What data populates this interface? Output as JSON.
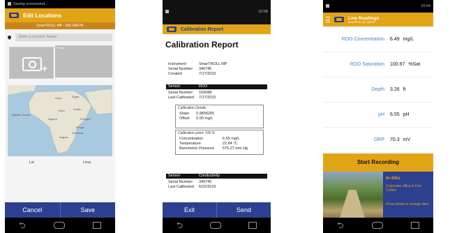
{
  "phone1": {
    "status_text": "Saving screenshot...",
    "title": "Edit Locations",
    "subtitle": "SmarTROLL MP - S/N 346745",
    "search_placeholder": "Enter a location Name",
    "photo2_label": "Photo",
    "map_labels": [
      "Atlantic Ocean",
      "Libya",
      "Egypt",
      "Chad",
      "Sudan",
      "Nigeria",
      "Angola",
      "Ethiopia",
      "Kenya",
      "Tanzania"
    ],
    "lat_label": "Lat",
    "long_label": "Long",
    "cancel_label": "Cancel",
    "save_label": "Save"
  },
  "phone2": {
    "status_time": "10:08",
    "title": "Calibration Report",
    "heading": "Calibration Report",
    "instrument_k": "Instrument",
    "instrument_v": "SmarTROLL MP",
    "serial_k": "Serial Number",
    "serial_v": "346745",
    "created_k": "Created",
    "created_v": "7/17/2015",
    "sensor1_k": "Sensor",
    "sensor1_v": "RDO",
    "s1_serial_k": "Serial Number",
    "s1_serial_v": "159088",
    "s1_cal_k": "Last Calibrated",
    "s1_cal_v": "7/17/2015",
    "cal_details": "Calibration Details",
    "slope_k": "Slope",
    "slope_v": "0.9858205",
    "offset_k": "Offset",
    "offset_v": "0.00 mg/L",
    "cal_point": "Calibration point: 100 %",
    "conc_k": "Concentration",
    "conc_v": "6.55 mg/L",
    "temp_k": "Temperature",
    "temp_v": "22.84 °C",
    "baro_k": "Barometric Pressure",
    "baro_v": "575.27 mm Hg",
    "sensor2_k": "Sensor",
    "sensor2_v": "Conductivity",
    "s2_serial_k": "Serial Number",
    "s2_serial_v": "346745",
    "s2_cal_k": "Last Calibrated",
    "s2_cal_v": "6/22/2015",
    "exit_label": "Exit",
    "send_label": "Send"
  },
  "phone3": {
    "status_time": "10:04",
    "title": "Live Readings",
    "subtitle": "SmarTROLL MP 346745",
    "readings": [
      {
        "label": "RDO Concentration",
        "value": "6.49",
        "unit": "mg/L"
      },
      {
        "label": "RDO Saturation",
        "value": "100.67",
        "unit": "%Sat"
      },
      {
        "label": "Depth",
        "value": "3.26",
        "unit": "ft"
      },
      {
        "label": "pH",
        "value": "6.55",
        "unit": "pH"
      },
      {
        "label": "ORP",
        "value": "70.3",
        "unit": "mV"
      }
    ],
    "start_label": "Start Recording",
    "insitu_title": "In-Situ",
    "insitu_desc": "Corporate office in Fort Collins",
    "insitu_hint": "Press photo to change sites"
  },
  "colors": {
    "accent": "#e2a417",
    "brand": "#2d3f8f",
    "label_blue": "#4d7fbf"
  },
  "icons": [
    "back-icon",
    "home-icon",
    "recent-apps-icon",
    "location-pin-icon",
    "camera-icon",
    "menu-icon"
  ]
}
